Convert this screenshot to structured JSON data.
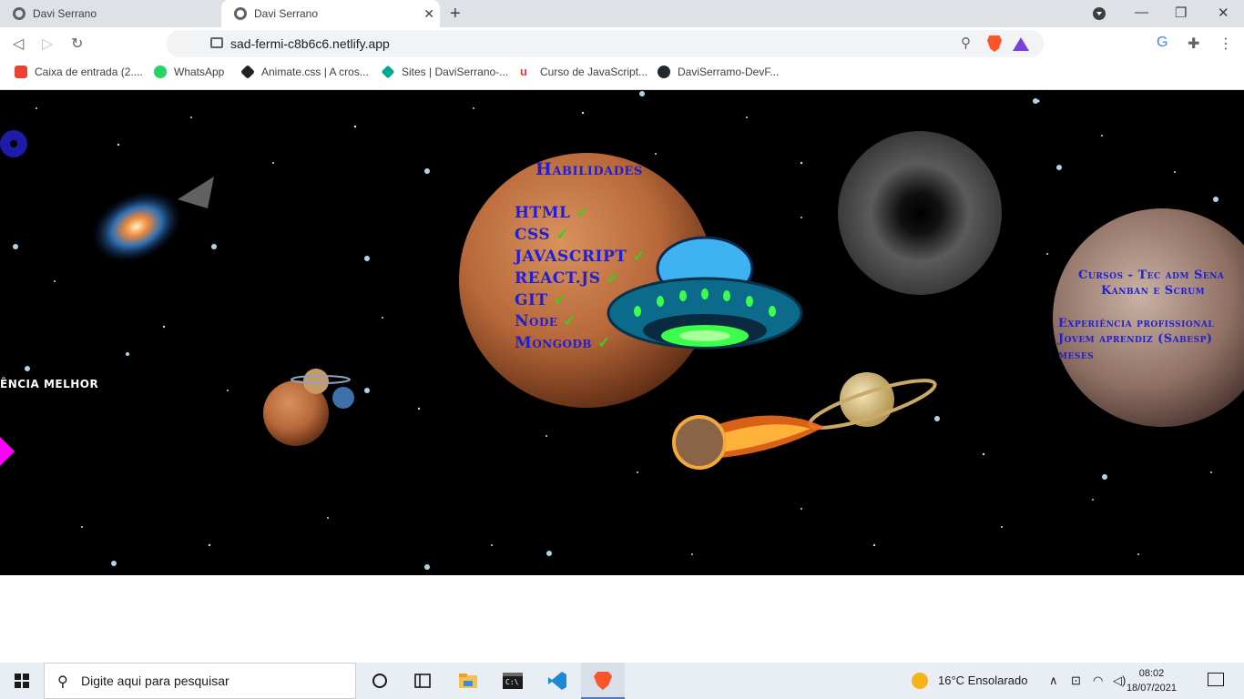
{
  "browser": {
    "tabs": [
      {
        "title": "Davi Serrano",
        "active": false
      },
      {
        "title": "Davi Serrano",
        "active": true
      }
    ],
    "url": "sad-fermi-c8b6c6.netlify.app",
    "bookmarks": [
      {
        "label": "Caixa de entrada (2....",
        "icon": "gmail-icon",
        "color": "#ea4335"
      },
      {
        "label": "WhatsApp",
        "icon": "whatsapp-icon",
        "color": "#25d366"
      },
      {
        "label": "Animate.css | A cros...",
        "icon": "animate-icon",
        "color": "#222222"
      },
      {
        "label": "Sites | DaviSerrano-...",
        "icon": "sites-icon",
        "color": "#00a98f"
      },
      {
        "label": "Curso de JavaScript...",
        "icon": "course-icon",
        "color": "#e53935"
      },
      {
        "label": "DaviSerramo-DevF...",
        "icon": "github-icon",
        "color": "#24292e"
      }
    ]
  },
  "page": {
    "skills_title": "Habilidades",
    "skills": [
      "HTML",
      "CSS",
      "JAVASCRIPT",
      "REACT.JS",
      "GIT",
      "Node",
      "Mongodb"
    ],
    "courses_line1": "Cursos - Tec adm Sena",
    "courses_line2": "Kanban e Scrum",
    "experience_line1": "Experiência profissional",
    "experience_line2": "Jovem aprendiz (Sabesp)",
    "experience_line3": "meses",
    "left_text": "ÊNCIA MELHOR",
    "colors": {
      "text_blue": "#1f1fd6",
      "check_green": "#34d31a",
      "magenta": "#ff00ff"
    }
  },
  "taskbar": {
    "search_placeholder": "Digite aqui para pesquisar",
    "weather": "16°C  Ensolarado",
    "time": "08:02",
    "date": "18/07/2021"
  }
}
